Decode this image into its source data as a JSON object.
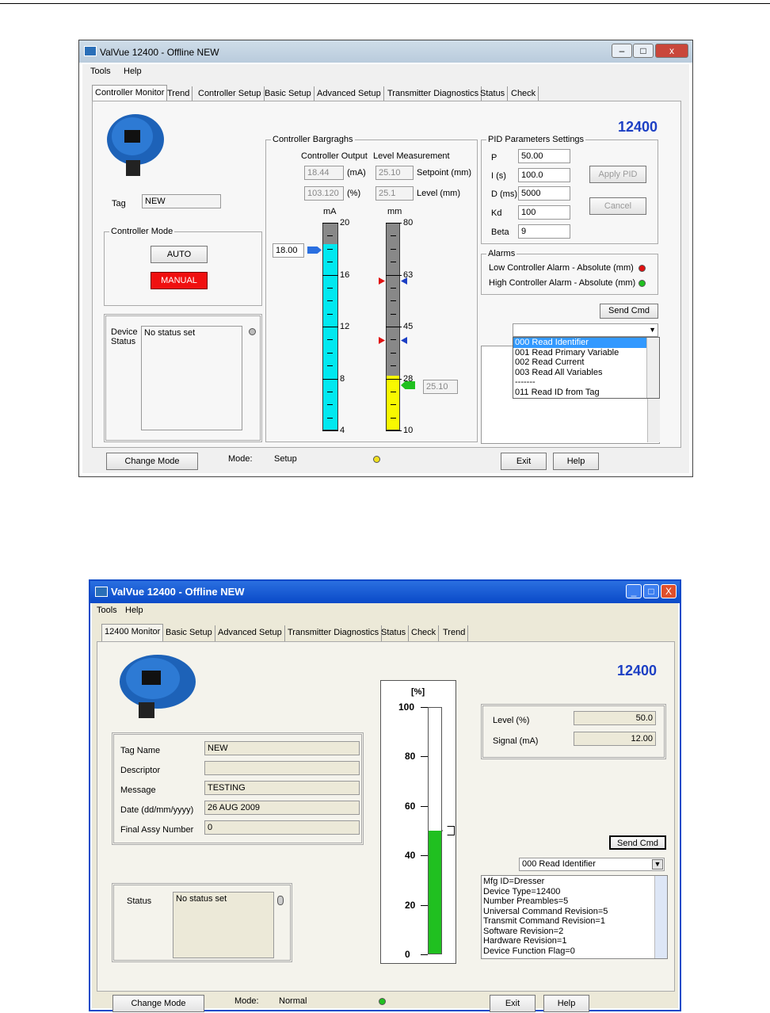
{
  "w1": {
    "title": "ValVue 12400 - Offline  NEW",
    "controls": {
      "min": "–",
      "max": "□",
      "close": "x"
    },
    "menu": [
      "Tools",
      "Help"
    ],
    "tabs": [
      "Controller Monitor",
      "Trend",
      "Controller Setup",
      "Basic Setup",
      "Advanced Setup",
      "Transmitter Diagnostics",
      "Status",
      "Check"
    ],
    "model": "12400",
    "tag_label": "Tag",
    "tag_value": "NEW",
    "mode_group": "Controller Mode",
    "auto": "AUTO",
    "manual": "MANUAL",
    "device_status_label": "Device\nStatus",
    "device_status_value": "No status set",
    "bargraphs": {
      "group": "Controller Bargraghs",
      "output_label": "Controller Output",
      "level_label": "Level Measurement",
      "out_ma": "18.44",
      "out_ma_unit": "(mA)",
      "out_pct": "103.120",
      "out_pct_unit": "(%)",
      "setpoint": "25.10",
      "setpoint_label": "Setpoint (mm)",
      "level": "25.1",
      "level_label2": "Level  (mm)",
      "ma_unit": "mA",
      "mm_unit": "mm",
      "ma_ticks": [
        "20",
        "16",
        "12",
        "8",
        "4"
      ],
      "mm_ticks": [
        "80",
        "63",
        "45",
        "28",
        "10"
      ],
      "ma_input": "18.00",
      "mm_readout": "25.10",
      "ma_fill_fraction": 0.9,
      "mm_fill_fraction": 0.26
    },
    "pid": {
      "group": "PID Parameters Settings",
      "rows": [
        {
          "label": "P",
          "value": "50.00"
        },
        {
          "label": "I  (s)",
          "value": "100.0"
        },
        {
          "label": "D (ms)",
          "value": "5000"
        },
        {
          "label": "Kd",
          "value": "100"
        },
        {
          "label": "Beta",
          "value": "9"
        }
      ],
      "apply": "Apply PID",
      "cancel": "Cancel"
    },
    "alarms": {
      "group": "Alarms",
      "low": "Low Controller Alarm -  Absolute  (mm)",
      "high": "High Controller Alarm -  Absolute  (mm)",
      "low_color": "#e01010",
      "high_color": "#20c020"
    },
    "send_cmd": "Send Cmd",
    "cmd_options": [
      "000 Read Identifier",
      "001 Read Primary Variable",
      "002 Read Current",
      "003 Read All Variables",
      "-------",
      "011 Read ID from Tag"
    ],
    "bottom": {
      "change_mode": "Change Mode",
      "mode_label": "Mode:",
      "mode_value": "Setup",
      "exit": "Exit",
      "help": "Help",
      "mode_color": "#f0e020"
    }
  },
  "w2": {
    "title": "ValVue 12400 - Offline  NEW",
    "controls": {
      "min": "_",
      "max": "□",
      "close": "X"
    },
    "menu": [
      "Tools",
      "Help"
    ],
    "tabs": [
      "12400 Monitor",
      "Basic Setup",
      "Advanced Setup",
      "Transmitter Diagnostics",
      "Status",
      "Check",
      "Trend"
    ],
    "model": "12400",
    "fields": [
      {
        "label": "Tag Name",
        "value": "NEW"
      },
      {
        "label": "Descriptor",
        "value": ""
      },
      {
        "label": "Message",
        "value": "TESTING"
      },
      {
        "label": "Date (dd/mm/yyyy)",
        "value": "26 AUG 2009"
      },
      {
        "label": "Final Assy Number",
        "value": "0"
      }
    ],
    "status_label": "Status",
    "status_value": "No status set",
    "gauge": {
      "unit": "[%]",
      "ticks": [
        "100",
        "80",
        "60",
        "40",
        "20",
        "0"
      ],
      "fill_fraction": 0.5
    },
    "level_label": "Level  (%)",
    "level_value": "50.0",
    "signal_label": "Signal (mA)",
    "signal_value": "12.00",
    "send_cmd": "Send Cmd",
    "cmd_selected": "000 Read Identifier",
    "info_lines": [
      "Mfg ID=Dresser",
      "Device Type=12400",
      "Number Preambles=5",
      "Universal Command Revision=5",
      "Transmit Command Revision=1",
      "Software Revision=2",
      "Hardware Revision=1",
      "Device Function Flag=0"
    ],
    "bottom": {
      "change_mode": "Change Mode",
      "mode_label": "Mode:",
      "mode_value": "Normal",
      "exit": "Exit",
      "help": "Help",
      "mode_color": "#20c020"
    }
  }
}
